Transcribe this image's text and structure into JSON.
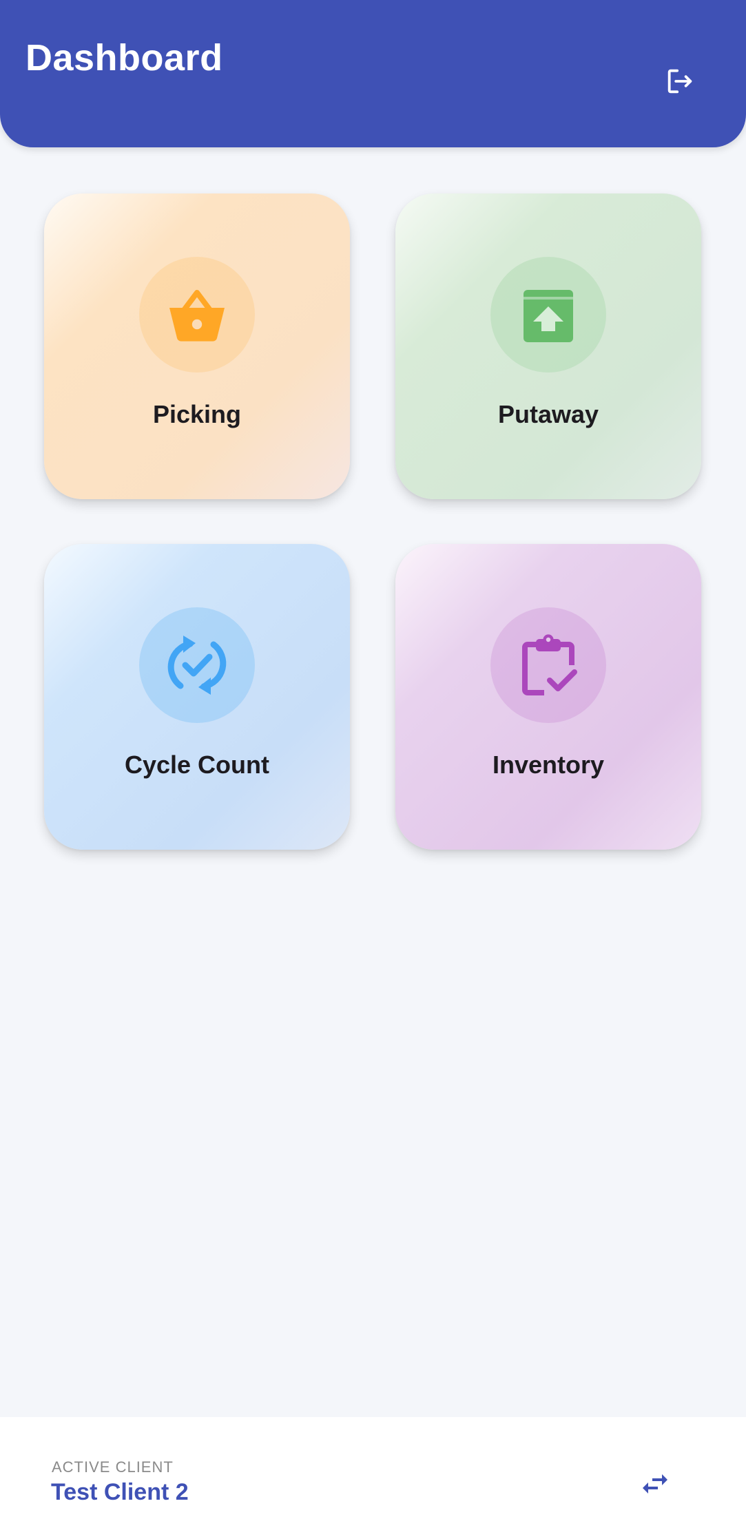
{
  "header": {
    "title": "Dashboard",
    "logout_icon": "logout-icon",
    "background_color": "#3f51b5"
  },
  "tiles": [
    {
      "label": "Picking",
      "icon": "basket-icon",
      "accent": "#ffa726"
    },
    {
      "label": "Putaway",
      "icon": "archive-upload-icon",
      "accent": "#66bb6a"
    },
    {
      "label": "Cycle Count",
      "icon": "sync-check-icon",
      "accent": "#42a5f5"
    },
    {
      "label": "Inventory",
      "icon": "clipboard-check-icon",
      "accent": "#ab47bc"
    }
  ],
  "footer": {
    "caption": "ACTIVE CLIENT",
    "client_name": "Test Client 2",
    "switch_icon": "swap-horizontal-icon"
  }
}
